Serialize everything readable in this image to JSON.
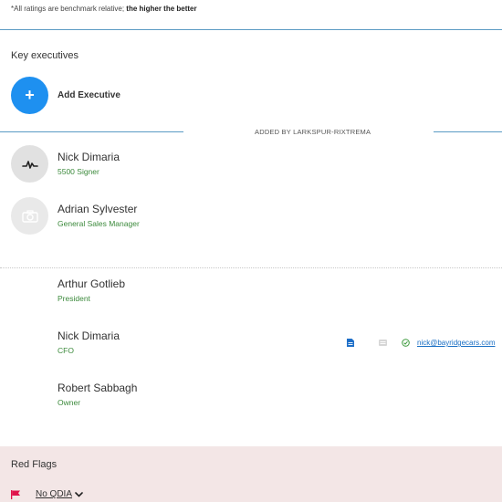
{
  "note": {
    "prefix": "*All ratings are benchmark relative; ",
    "emphasis": "the higher the better"
  },
  "key_executives": {
    "title": "Key executives",
    "add_label": "Add Executive",
    "add_symbol": "+",
    "added_by": "ADDED BY LARKSPUR-RIXTREMA",
    "added": [
      {
        "name": "Nick Dimaria",
        "role": "5500 Signer",
        "avatar_icon": "signature-icon"
      },
      {
        "name": "Adrian Sylvester",
        "role": "General Sales Manager",
        "avatar_icon": "camera-icon"
      }
    ],
    "others": [
      {
        "name": "Arthur Gotlieb",
        "role": "President"
      },
      {
        "name": "Nick Dimaria",
        "role": "CFO",
        "email": "nick@bayridgecars.com"
      },
      {
        "name": "Robert Sabbagh",
        "role": "Owner"
      }
    ]
  },
  "red_flags": {
    "title": "Red Flags",
    "item": "No QDIA",
    "flag_color": "#e0144c"
  },
  "colors": {
    "accent": "#1e90f0",
    "role_green": "#3c8a3c",
    "rule_blue": "#5b9bc4",
    "link_blue": "#1a6fc4",
    "red_flag_bg": "#f3e6e6"
  }
}
